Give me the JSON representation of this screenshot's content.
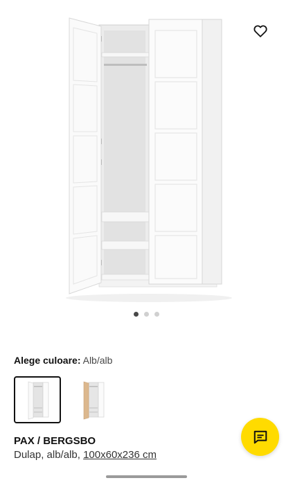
{
  "product": {
    "name": "PAX / BERGSBO",
    "description_prefix": "Dulap, alb/alb, ",
    "measurements": "100x60x236 cm"
  },
  "color_selector": {
    "label": "Alege culoare:",
    "selected_value": "Alb/alb",
    "options": [
      {
        "name": "alb/alb",
        "selected": true,
        "swatch_color": "#f5f5f5"
      },
      {
        "name": "white stained oak",
        "selected": false,
        "swatch_color": "#d9b48a"
      }
    ]
  },
  "carousel": {
    "total": 3,
    "active_index": 0
  },
  "icons": {
    "favorite": "heart-icon",
    "chat": "chat-icon"
  },
  "colors": {
    "accent_yellow": "#ffdb00",
    "text": "#111111",
    "active_dot": "#484848",
    "inactive_dot": "#d0d0d0"
  }
}
